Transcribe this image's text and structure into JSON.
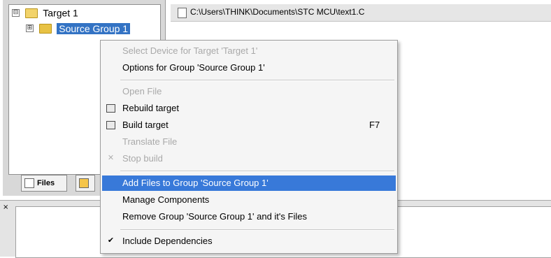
{
  "project_tree": {
    "target_label": "Target 1",
    "group_label": "Source Group 1",
    "target_expander": "⊟",
    "group_expander": "⊞"
  },
  "panel_tabs": {
    "files_label": "Files"
  },
  "editor": {
    "file_path": "C:\\Users\\THINK\\Documents\\STC MCU\\text1.C"
  },
  "output": {
    "close_glyph": "×"
  },
  "context_menu": {
    "items": [
      {
        "label": "Select Device for Target 'Target 1'",
        "enabled": false
      },
      {
        "label": "Options for Group 'Source Group 1'",
        "enabled": true
      },
      {
        "label": "Open File",
        "enabled": false
      },
      {
        "label": "Rebuild target",
        "enabled": true,
        "icon": "rebuild-icon"
      },
      {
        "label": "Build target",
        "enabled": true,
        "shortcut": "F7",
        "icon": "build-icon"
      },
      {
        "label": "Translate File",
        "enabled": false
      },
      {
        "label": "Stop build",
        "enabled": false,
        "icon": "stop-build-icon"
      },
      {
        "label": "Add Files to Group 'Source Group 1'",
        "enabled": true,
        "highlighted": true
      },
      {
        "label": "Manage Components",
        "enabled": true
      },
      {
        "label": "Remove Group 'Source Group 1' and it's Files",
        "enabled": true
      },
      {
        "label": "Include Dependencies",
        "enabled": true,
        "checked": true
      }
    ],
    "checkmark": "✔"
  },
  "colors": {
    "highlight": "#3879d9",
    "selected_tree_item": "#3373c4",
    "disabled_text": "#a9a9a9"
  }
}
